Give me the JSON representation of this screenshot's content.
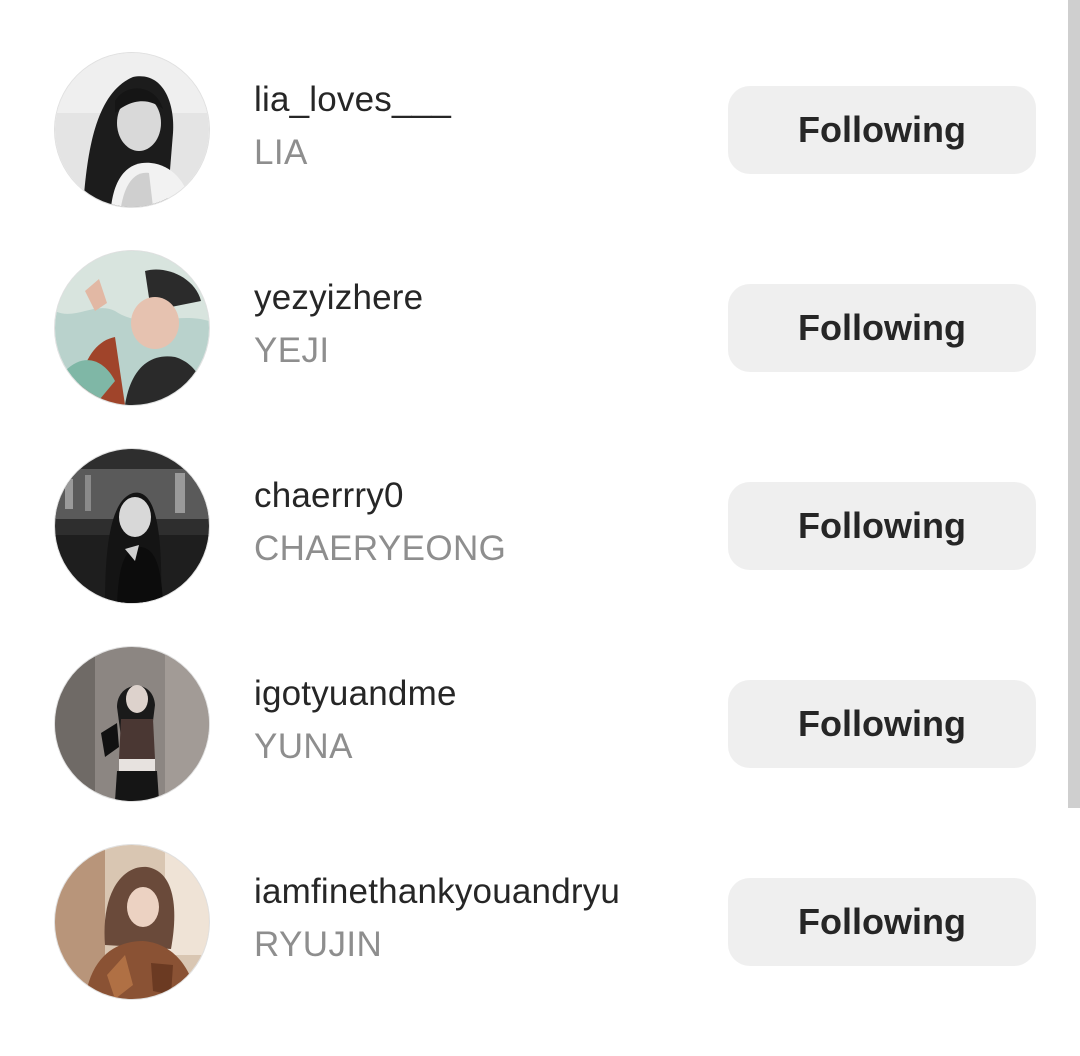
{
  "following_list": [
    {
      "username": "lia_loves___",
      "fullname": "LIA",
      "button_label": "Following"
    },
    {
      "username": "yezyizhere",
      "fullname": "YEJI",
      "button_label": "Following"
    },
    {
      "username": "chaerrry0",
      "fullname": "CHAERYEONG",
      "button_label": "Following"
    },
    {
      "username": "igotyuandme",
      "fullname": "YUNA",
      "button_label": "Following"
    },
    {
      "username": "iamfinethankyouandryu",
      "fullname": "RYUJIN",
      "button_label": "Following"
    }
  ],
  "colors": {
    "username": "#262626",
    "fullname": "#8e8e8e",
    "button_bg": "#efefef",
    "button_text": "#262626",
    "scrollbar": "#cfcfcf"
  }
}
